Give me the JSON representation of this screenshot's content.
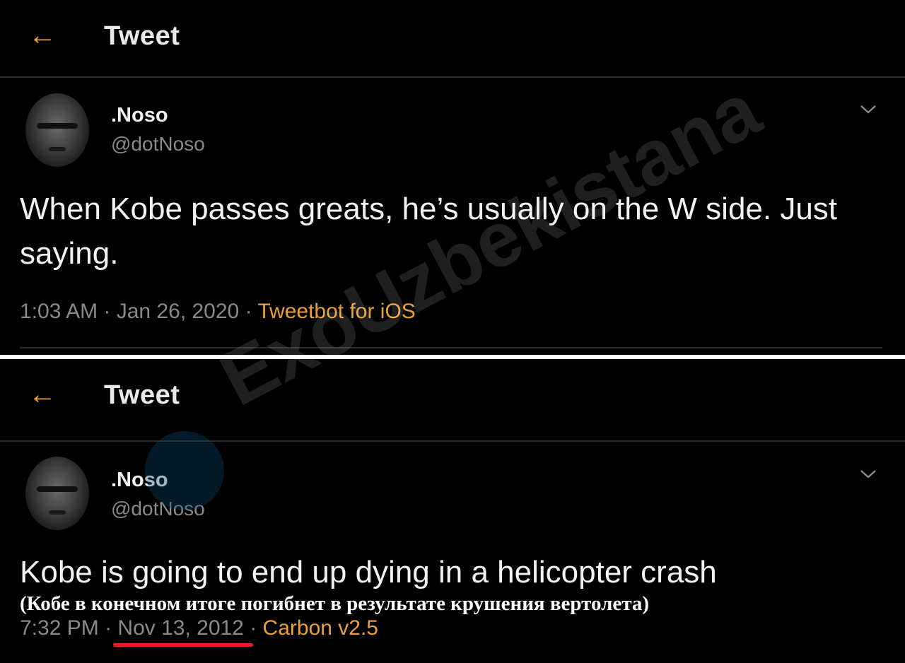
{
  "tweets": [
    {
      "header_title": "Tweet",
      "display_name": ".Noso",
      "handle": "@dotNoso",
      "text": "When Kobe passes greats, he’s usually on the W side. Just saying.",
      "time": "1:03 AM",
      "date": "Jan 26, 2020",
      "source": "Tweetbot for iOS"
    },
    {
      "header_title": "Tweet",
      "display_name": ".Noso",
      "handle": "@dotNoso",
      "text": "Kobe is going to end up dying in a helicopter crash",
      "time": "7:32 PM",
      "date": "Nov 13, 2012",
      "source": "Carbon v2.5"
    }
  ],
  "translation": "(Кобе в конечном итоге погибнет в результате крушения вертолета)",
  "watermark": "ExoUzbekistana",
  "icons": {
    "back": "back-arrow-icon",
    "more": "chevron-down-icon",
    "watermark_logo": "telegram-icon"
  },
  "colors": {
    "accent": "#e8a03a",
    "background": "#000000",
    "underline": "#e31e24"
  }
}
